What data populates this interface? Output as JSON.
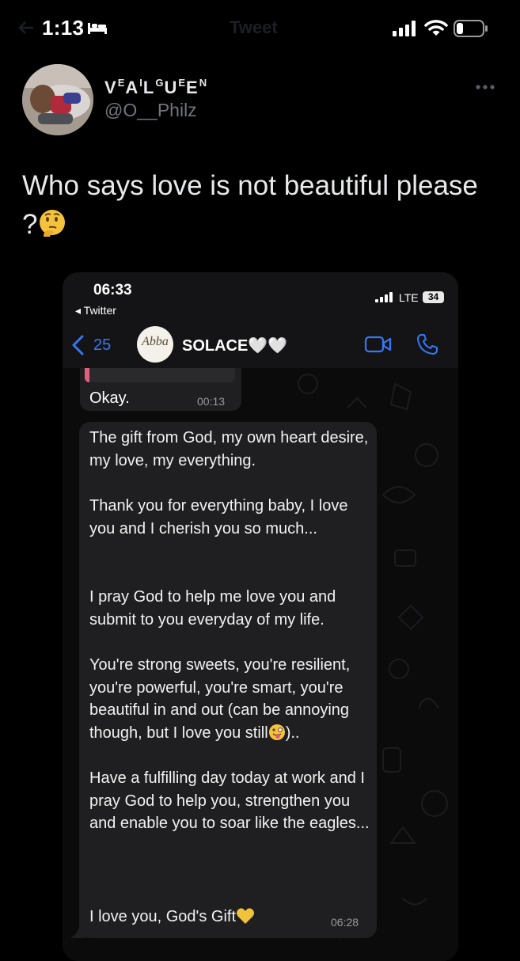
{
  "status_bar": {
    "time": "1:13",
    "ghost_title": "Tweet"
  },
  "tweet": {
    "display_name_parts": [
      "V",
      "E",
      "A",
      "I",
      "L",
      "G",
      "U",
      "E",
      "E",
      "N"
    ],
    "handle": "@O__Philz",
    "text": "Who says love is not beautiful please ?"
  },
  "embed": {
    "status": {
      "time": "06:33",
      "back_app": "◂ Twitter",
      "network": "LTE",
      "battery": "34"
    },
    "chat": {
      "back_count": "25",
      "contact_avatar_text": "Abba",
      "contact_name": "SOLACE🤍🤍",
      "previous_message": {
        "text": "Okay.",
        "time": "00:13"
      },
      "message": {
        "paragraphs": [
          "The gift from God, my own heart desire, my love, my everything.",
          "Thank you for everything baby, I love you and I cherish you so much...",
          "I pray God to help me love you and submit to you everyday of my life.",
          "You're strong sweets, you're resilient, you're powerful, you're smart, you're beautiful in and out (can be annoying though, but I love you still",
          ")..",
          "Have a fulfilling day today at work and I pray God to help you, strengthen you and enable you to soar like the eagles...",
          "I love you, God's Gift"
        ],
        "time": "06:28"
      }
    }
  },
  "colors": {
    "background": "#000000",
    "text": "#e7e9ea",
    "muted": "#71767b",
    "bubble": "#1f1f22",
    "ios_blue": "#3478f6"
  },
  "icons": [
    "sleep-bed-icon",
    "cellular-signal-icon",
    "wifi-icon",
    "battery-icon",
    "more-options-icon",
    "thinking-face-emoji-icon",
    "chevron-left-icon",
    "video-call-icon",
    "phone-call-icon",
    "winking-tongue-emoji-icon",
    "yellow-heart-emoji-icon"
  ]
}
